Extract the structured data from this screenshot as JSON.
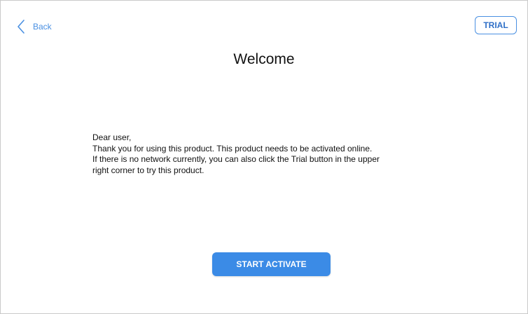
{
  "header": {
    "back_label": "Back",
    "back_icon": "chevron-left-icon",
    "trial_label": "TRIAL"
  },
  "title": "Welcome",
  "message": {
    "line1": "Dear user,",
    "line2": "Thank you for using this product. This product needs to be activated online.",
    "line3": "If there is no network currently, you can also click the Trial button in the upper",
    "line4": "right corner to try this product."
  },
  "actions": {
    "start_label": "START ACTIVATE"
  },
  "colors": {
    "accent": "#3b8be6",
    "link": "#4a90e2",
    "border": "#c9c9c9"
  }
}
